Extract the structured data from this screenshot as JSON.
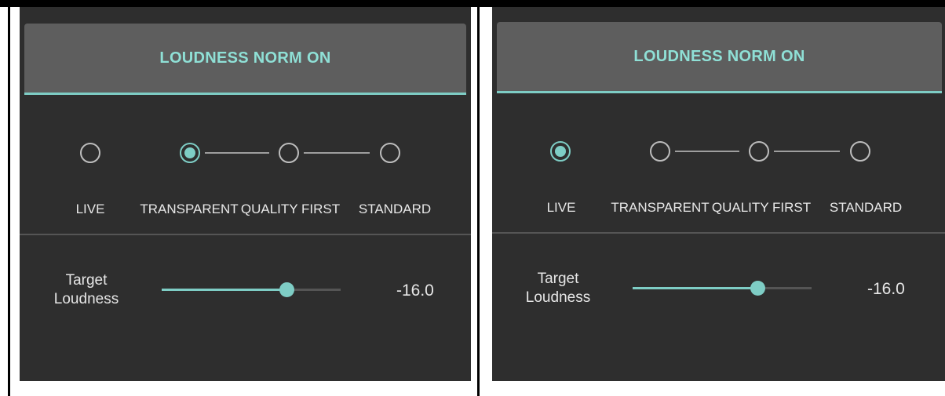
{
  "panels": [
    {
      "header_label": "LOUDNESS NORM ON",
      "modes": [
        {
          "label": "LIVE",
          "selected": false
        },
        {
          "label": "TRANSPARENT",
          "selected": true
        },
        {
          "label": "QUALITY FIRST",
          "selected": false
        },
        {
          "label": "STANDARD",
          "selected": false
        }
      ],
      "target_label_line1": "Target",
      "target_label_line2": "Loudness",
      "target_value": "-16.0",
      "slider_fraction": 0.7
    },
    {
      "header_label": "LOUDNESS NORM ON",
      "modes": [
        {
          "label": "LIVE",
          "selected": true
        },
        {
          "label": "TRANSPARENT",
          "selected": false
        },
        {
          "label": "QUALITY FIRST",
          "selected": false
        },
        {
          "label": "STANDARD",
          "selected": false
        }
      ],
      "target_label_line1": "Target",
      "target_label_line2": "Loudness",
      "target_value": "-16.0",
      "slider_fraction": 0.7
    }
  ],
  "colors": {
    "accent": "#7ecdc5",
    "panel_bg": "#2e2e2e",
    "header_bg": "#5e5e5e"
  }
}
